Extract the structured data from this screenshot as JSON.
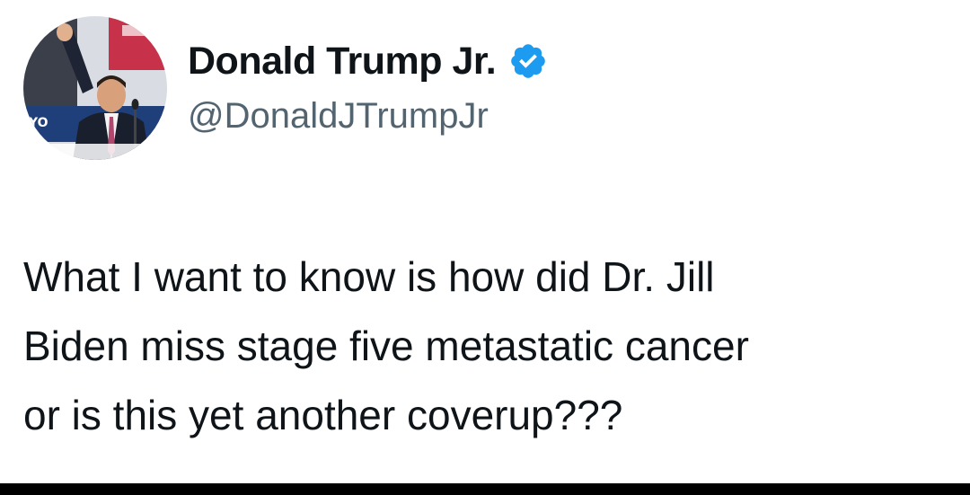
{
  "tweet": {
    "author": {
      "display_name": "Donald Trump Jr.",
      "handle": "@DonaldJTrumpJr",
      "verified": true,
      "verified_badge_color": "#1d9bf0",
      "avatar_icon": "profile-photo"
    },
    "text_lines": [
      "What I want to know is how did Dr. Jill",
      "Biden miss stage five metastatic cancer",
      "or is this yet another coverup???"
    ]
  },
  "colors": {
    "name": "#0f1419",
    "handle": "#536471",
    "text": "#0f1419",
    "background": "#ffffff"
  }
}
